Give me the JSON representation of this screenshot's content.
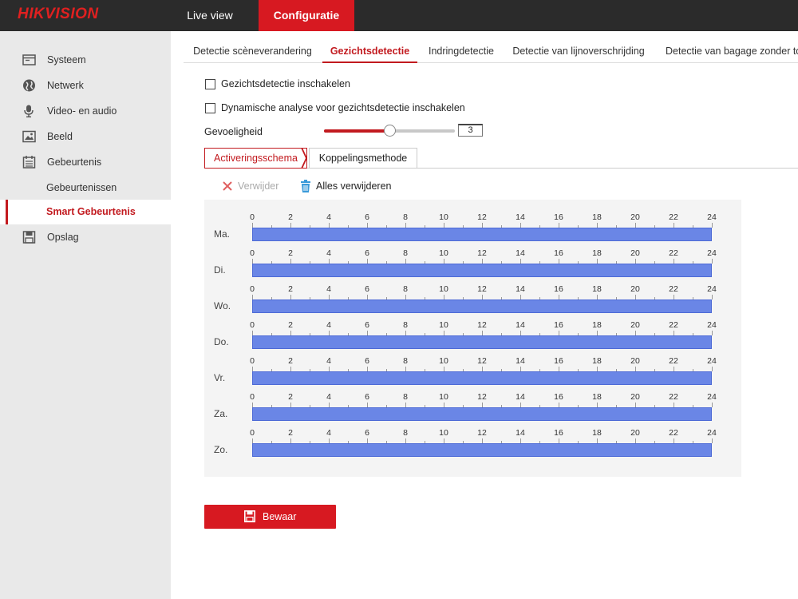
{
  "brand": {
    "logo": "HIKVISION",
    "accent": "#d71921"
  },
  "topnav": {
    "live": "Live view",
    "config": "Configuratie"
  },
  "sidebar": {
    "items": [
      {
        "label": "Systeem",
        "icon": "monitor-icon"
      },
      {
        "label": "Netwerk",
        "icon": "globe-icon"
      },
      {
        "label": "Video- en audio",
        "icon": "microphone-icon"
      },
      {
        "label": "Beeld",
        "icon": "image-icon"
      },
      {
        "label": "Gebeurtenis",
        "icon": "calendar-icon"
      },
      {
        "label": "Gebeurtenissen",
        "icon": ""
      },
      {
        "label": "Smart Gebeurtenis",
        "icon": "",
        "active": true
      },
      {
        "label": "Opslag",
        "icon": "save-disk-icon"
      }
    ]
  },
  "tabs": [
    "Detectie scèneverandering",
    "Gezichtsdetectie",
    "Indringdetectie",
    "Detectie van lijnoverschrijding",
    "Detectie van bagage zonder to"
  ],
  "form": {
    "enable_label": "Gezichtsdetectie inschakelen",
    "dynamic_label": "Dynamische analyse voor gezichtsdetectie inschakelen",
    "sensitivity_label": "Gevoeligheid",
    "sensitivity_value": "3",
    "sensitivity_fraction": 0.5
  },
  "subtabs": {
    "schedule": "Activeringsschema",
    "linkage": "Koppelingsmethode"
  },
  "actions": {
    "delete": "Verwijder",
    "delete_all": "Alles verwijderen"
  },
  "schedule": {
    "hours": [
      "0",
      "2",
      "4",
      "6",
      "8",
      "10",
      "12",
      "14",
      "16",
      "18",
      "20",
      "22",
      "24"
    ],
    "days": [
      {
        "label": "Ma.",
        "start": 0,
        "end": 24
      },
      {
        "label": "Di.",
        "start": 0,
        "end": 24
      },
      {
        "label": "Wo.",
        "start": 0,
        "end": 24
      },
      {
        "label": "Do.",
        "start": 0,
        "end": 24
      },
      {
        "label": "Vr.",
        "start": 0,
        "end": 24
      },
      {
        "label": "Za.",
        "start": 0,
        "end": 24
      },
      {
        "label": "Zo.",
        "start": 0,
        "end": 24
      }
    ]
  },
  "save_label": "Bewaar"
}
